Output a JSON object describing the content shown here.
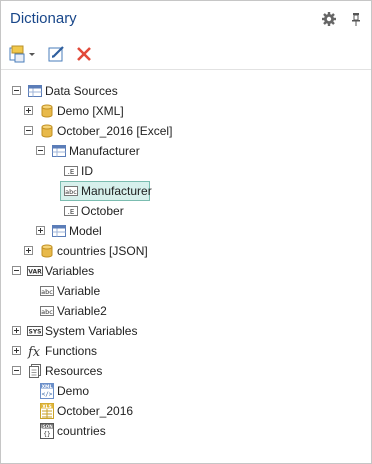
{
  "header": {
    "title": "Dictionary",
    "settings_icon": "gear-icon",
    "pin_icon": "pin-icon"
  },
  "toolbar": {
    "new_icon": "new-item-dropdown-icon",
    "edit_icon": "edit-icon",
    "delete_icon": "delete-icon"
  },
  "tree": {
    "data_sources": {
      "label": "Data Sources",
      "demo": "Demo [XML]",
      "october": "October_2016 [Excel]",
      "manufacturer_table": "Manufacturer",
      "columns": [
        "ID",
        "Manufacturer",
        "October"
      ],
      "model": "Model",
      "countries": "countries [JSON]"
    },
    "variables": {
      "label": "Variables",
      "items": [
        "Variable",
        "Variable2"
      ]
    },
    "system_variables": "System Variables",
    "functions": "Functions",
    "resources": {
      "label": "Resources",
      "items": [
        "Demo",
        "October_2016",
        "countries"
      ]
    }
  },
  "colors": {
    "title": "#19478a",
    "selection_bg": "#d7f0ec",
    "selection_border": "#7bbcb0",
    "database": "#e8b94a"
  }
}
